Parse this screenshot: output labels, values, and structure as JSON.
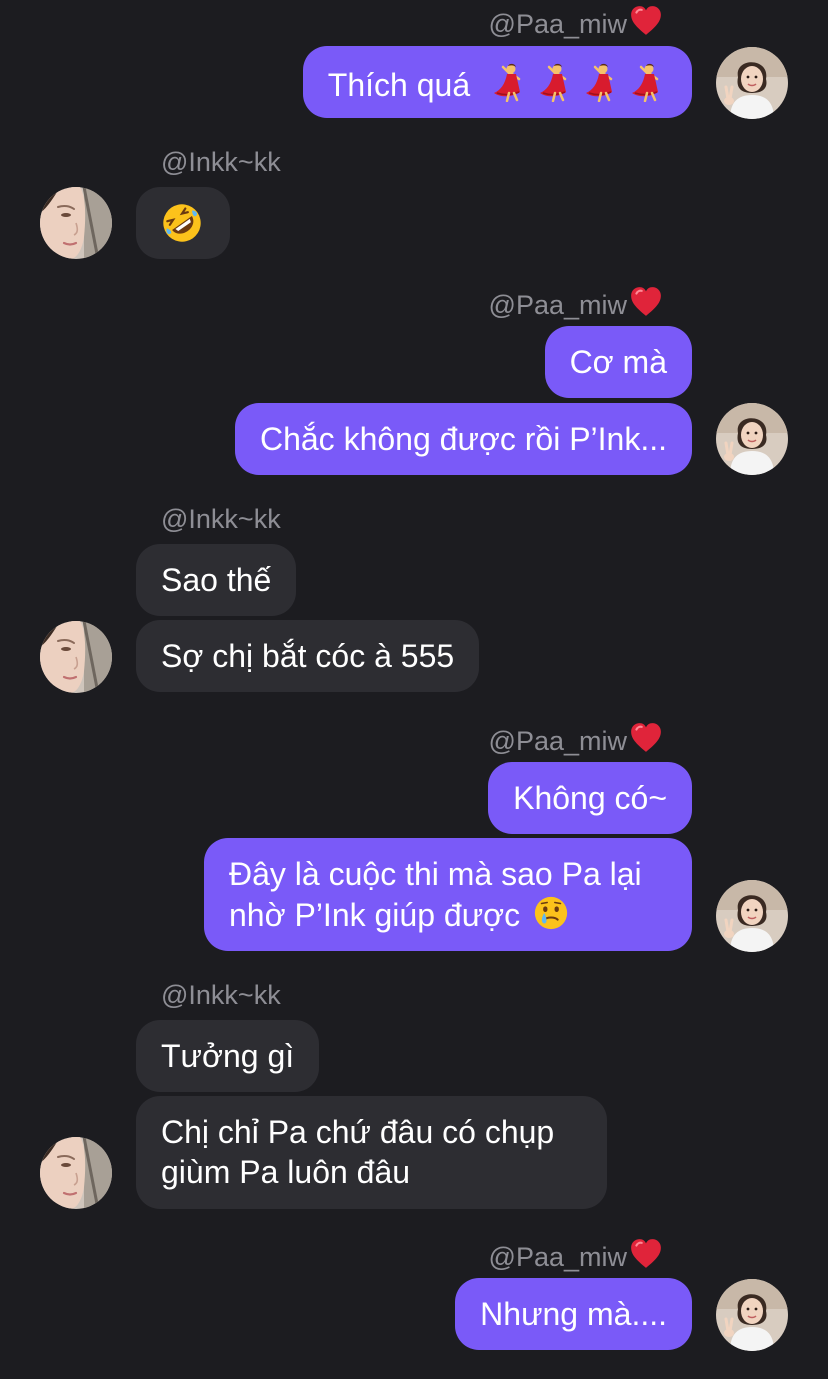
{
  "colors": {
    "background": "#1c1c20",
    "my_bubble": "#7a5af8",
    "their_bubble": "#2d2d32",
    "sender_text": "#8e8e95"
  },
  "contacts": {
    "me": {
      "handle": "@Paa_miw",
      "badge_icon": "red-heart-icon"
    },
    "other": {
      "handle": "@Inkk~kk"
    }
  },
  "messages": [
    {
      "group": 1,
      "from": "me",
      "text": "Thích quá",
      "emoji": "dancer-icon x4"
    },
    {
      "group": 2,
      "from": "other",
      "text": "",
      "emoji": "rolling-laughing-icon"
    },
    {
      "group": 3,
      "from": "me",
      "text": "Cơ mà"
    },
    {
      "group": 3,
      "from": "me",
      "text": "Chắc không được rồi P’Ink..."
    },
    {
      "group": 4,
      "from": "other",
      "text": "Sao thế"
    },
    {
      "group": 4,
      "from": "other",
      "text": "Sợ chị bắt cóc à 555"
    },
    {
      "group": 5,
      "from": "me",
      "text": "Không có~"
    },
    {
      "group": 5,
      "from": "me",
      "lines": [
        "Đây là cuộc thi mà sao Pa lại",
        "nhờ P’Ink giúp được"
      ],
      "emoji": "crying-smile-icon"
    },
    {
      "group": 6,
      "from": "other",
      "text": "Tưởng gì"
    },
    {
      "group": 6,
      "from": "other",
      "lines": [
        "Chị chỉ Pa chứ đâu có chụp",
        "giùm Pa luôn đâu"
      ]
    },
    {
      "group": 7,
      "from": "me",
      "text": "Nhưng mà...."
    }
  ]
}
